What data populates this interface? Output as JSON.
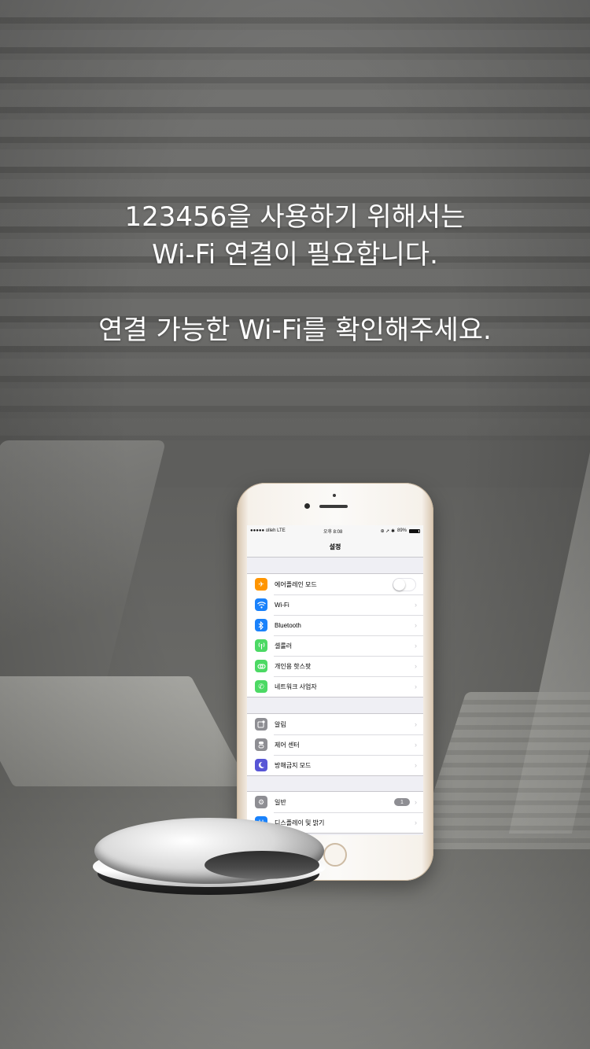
{
  "headline": {
    "line1": "123456을 사용하기 위해서는",
    "line2": "Wi-Fi 연결이 필요합니다.",
    "line3": "연결 가능한 Wi-Fi를 확인해주세요."
  },
  "phone": {
    "status_bar": {
      "carrier": "●●●●● olleh  LTE",
      "time": "오후 8:08",
      "indicators": "⊕ ➚ ✱",
      "battery_percent": "89%",
      "battery_level": 0.89
    },
    "nav_title": "설정",
    "groups": [
      {
        "rows": [
          {
            "label": "에어플레인 모드",
            "icon": "airplane-icon",
            "icon_color": "#ff9500",
            "accessory": "toggle",
            "toggle_on": false
          },
          {
            "label": "Wi-Fi",
            "icon": "wifi-icon",
            "icon_color": "#1a82fb",
            "accessory": "chevron"
          },
          {
            "label": "Bluetooth",
            "icon": "bluetooth-icon",
            "icon_color": "#1a82fb",
            "accessory": "chevron"
          },
          {
            "label": "셀룰러",
            "icon": "cellular-icon",
            "icon_color": "#4cd964",
            "accessory": "chevron"
          },
          {
            "label": "개인용 핫스팟",
            "icon": "hotspot-icon",
            "icon_color": "#4cd964",
            "accessory": "chevron"
          },
          {
            "label": "네트워크 사업자",
            "icon": "phone-icon",
            "icon_color": "#4cd964",
            "accessory": "chevron"
          }
        ]
      },
      {
        "rows": [
          {
            "label": "알림",
            "icon": "notifications-icon",
            "icon_color": "#8e8e93",
            "accessory": "chevron"
          },
          {
            "label": "제어 센터",
            "icon": "control-center-icon",
            "icon_color": "#8e8e93",
            "accessory": "chevron"
          },
          {
            "label": "방해금지 모드",
            "icon": "moon-icon",
            "icon_color": "#5856d6",
            "accessory": "chevron"
          }
        ]
      },
      {
        "rows": [
          {
            "label": "일반",
            "icon": "gear-icon",
            "icon_color": "#8e8e93",
            "accessory": "chevron",
            "badge": "1"
          },
          {
            "label": "디스플레이 및 밝기",
            "icon": "display-icon",
            "icon_color": "#1a82fb",
            "accessory": "chevron"
          }
        ]
      }
    ]
  }
}
